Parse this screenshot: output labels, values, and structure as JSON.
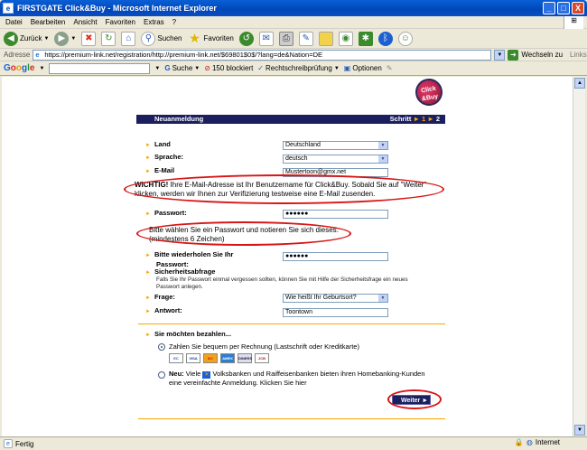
{
  "window": {
    "title": "FIRSTGATE Click&Buy - Microsoft Internet Explorer",
    "buttons": [
      "_",
      "□",
      "X"
    ]
  },
  "menu": [
    "Datei",
    "Bearbeiten",
    "Ansicht",
    "Favoriten",
    "Extras",
    "?"
  ],
  "toolbar": {
    "back": "Zurück",
    "search": "Suchen",
    "favorites": "Favoriten"
  },
  "address": {
    "label": "Adresse",
    "url": "https://premium-link.net/registration/http://premium-link.net/$69801$0$/?lang=de&Nation=DE",
    "go": "Wechseln zu",
    "links": "Links"
  },
  "google": {
    "logo": [
      "G",
      "o",
      "o",
      "g",
      "l",
      "e"
    ],
    "search": "Suche",
    "blocked": "150 blockiert",
    "spell": "Rechtschreibprüfung",
    "options": "Optionen"
  },
  "logo": {
    "line1": "Click",
    "line2": "&Buy"
  },
  "header": {
    "title": "Neuanmeldung",
    "step_label": "Schritt",
    "step_active": "1",
    "step_next": "2"
  },
  "form": {
    "land": {
      "label": "Land",
      "value": "Deutschland"
    },
    "sprache": {
      "label": "Sprache:",
      "value": "deutsch"
    },
    "email": {
      "label": "E-Mail",
      "value": "Mustertoon@gmx.net"
    },
    "notice_strong": "WICHTIG!",
    "notice_text": " Ihre E-Mail-Adresse ist Ihr Benutzername für Click&Buy. Sobald Sie auf \"Weiter\" klicken, werden wir Ihnen zur Verifizierung testweise eine E-Mail zusenden.",
    "passwort": {
      "label": "Passwort:",
      "value": "●●●●●●"
    },
    "password_hint_1": "Bitte wählen Sie ein Passwort und notieren Sie sich dieses.",
    "password_hint_2": "(mindestens 6 Zeichen)",
    "repeat": {
      "label_1": "Bitte wiederholen Sie Ihr",
      "label_2": "Passwort:",
      "value": "●●●●●●"
    },
    "security": {
      "label": "Sicherheitsabfrage",
      "hint_1": "Falls Sie Ihr Passwort einmal vergessen sollten, können Sie mit Hilfe der Sicherheitsfrage ein neues",
      "hint_2": "Passwort anlegen."
    },
    "frage": {
      "label": "Frage:",
      "value": "Wie heißt Ihr Geburtsort?"
    },
    "antwort": {
      "label": "Antwort:",
      "value": "Toontown"
    }
  },
  "payment": {
    "heading": "Sie möchten bezahlen...",
    "option1": "Zahlen Sie bequem per Rechnung (Lastschrift oder Kreditkarte)",
    "cards": [
      "EC",
      "VISA",
      "MC",
      "AMEX",
      "DINERS",
      "JCB"
    ],
    "option2_strong": "Neu:",
    "option2_pre": " Viele ",
    "option2_line1": " Volksbanken und Raiffeisenbanken bieten ihren Homebanking-Kunden",
    "option2_line2": "eine vereinfachte Anmeldung. Klicken Sie hier"
  },
  "submit": {
    "label": "Weiter ►"
  },
  "status": {
    "text": "Fertig",
    "zone": "Internet"
  },
  "colors": {
    "navy": "#1b1f5e",
    "orange": "#f7a600",
    "highlight": "#d81515"
  }
}
